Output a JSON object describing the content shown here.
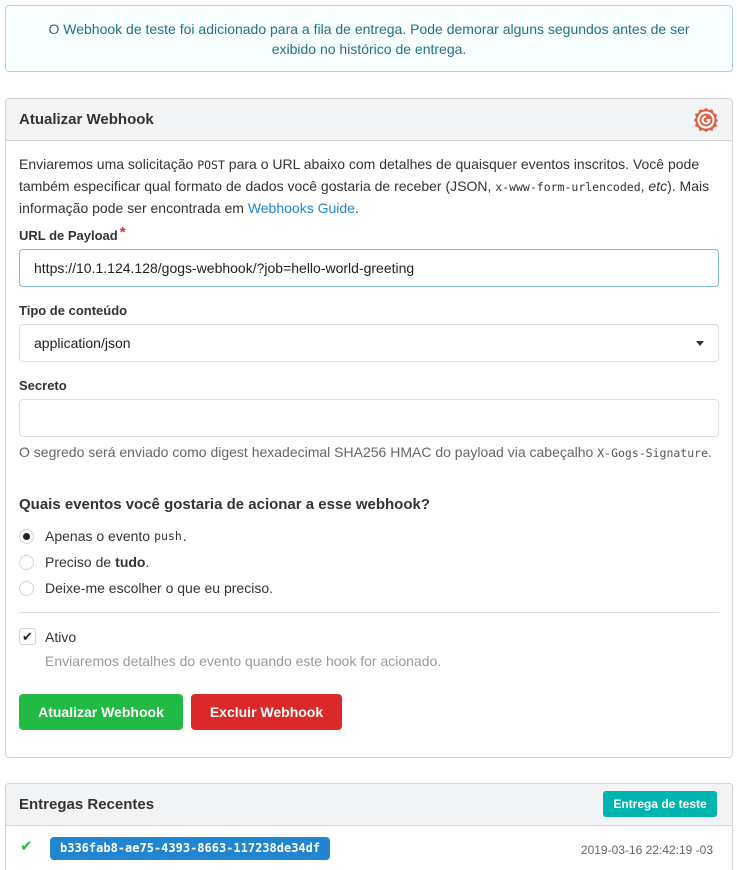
{
  "flash": {
    "message": "O Webhook de teste foi adicionado para a fila de entrega. Pode demorar alguns segundos antes de ser exibido no histórico de entrega."
  },
  "webhook_form": {
    "title": "Atualizar Webhook",
    "logo_icon": "gogs-logo-icon",
    "description": {
      "part1": "Enviaremos uma solicitação ",
      "post_code": "POST",
      "part2": " para o URL abaixo com detalhes de quaisquer eventos inscritos. Você pode também especificar qual formato de dados você gostaria de receber (JSON, ",
      "form_code": "x-www-form-urlencoded",
      "part3": ", ",
      "etc": "etc",
      "part4": "). Mais informação pode ser encontrada em ",
      "link": "Webhooks Guide",
      "part5": "."
    },
    "payload_url_label": "URL de Payload",
    "required_mark": "*",
    "payload_url_value": "https://10.1.124.128/gogs-webhook/?job=hello-world-greeting",
    "content_type_label": "Tipo de conteúdo",
    "content_type_value": "application/json",
    "secret_label": "Secreto",
    "secret_value": "",
    "secret_help_part1": "O segredo será enviado como digest hexadecimal SHA256 HMAC do payload via cabeçalho ",
    "secret_help_code": "X-Gogs-Signature",
    "secret_help_part2": ".",
    "events_question": "Quais eventos você gostaria de acionar a esse webhook?",
    "event_options": {
      "push_only_prefix": "Apenas o evento",
      "push_only_code": "push",
      "push_only_suffix": ".",
      "everything_prefix": "Preciso de ",
      "everything_bold": "tudo",
      "everything_suffix": ".",
      "choose": "Deixe-me escolher o que eu preciso."
    },
    "selected_event": "push_only",
    "active_label": "Ativo",
    "active_checked": true,
    "active_help": "Enviaremos detalhes do evento quando este hook for acionado.",
    "update_button": "Atualizar Webhook",
    "delete_button": "Excluir Webhook"
  },
  "recent_deliveries": {
    "title": "Entregas Recentes",
    "test_button": "Entrega de teste",
    "items": [
      {
        "status": "success",
        "uuid": "b336fab8-ae75-4393-8663-117238de34df",
        "timestamp": "2019-03-16 22:42:19 -03"
      }
    ]
  },
  "colors": {
    "green": "#21ba45",
    "red": "#db2828",
    "teal": "#00b5ad",
    "blue": "#2185d0",
    "flash_text": "#276f86"
  }
}
